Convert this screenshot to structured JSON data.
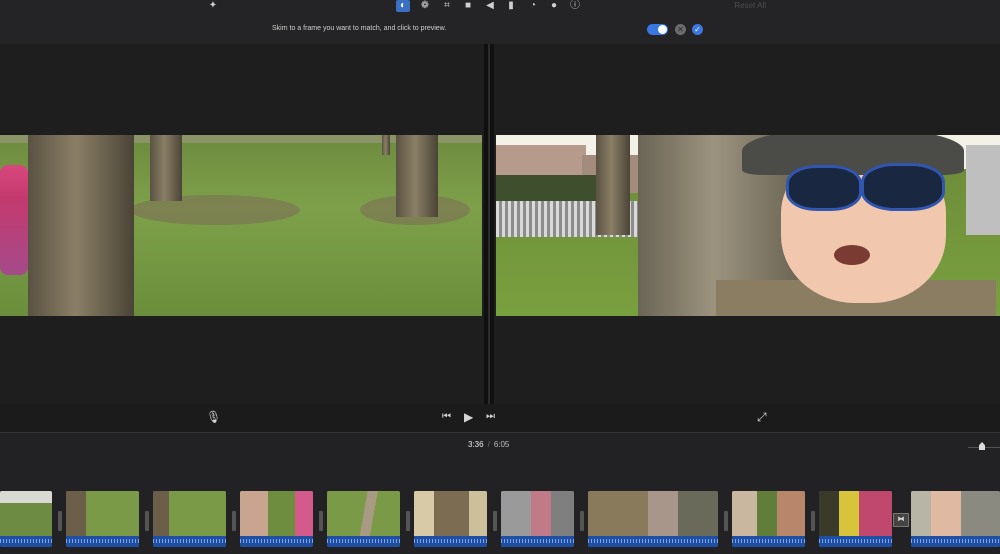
{
  "toolbar": {
    "icons": [
      "magic-wand",
      "color-balance",
      "color-correction",
      "crop",
      "camera-stabilization",
      "volume",
      "noise-reduction",
      "speed",
      "video-overlay",
      "info"
    ],
    "reset_all": "Reset All"
  },
  "hint": {
    "text": "Skim to a frame you want to match, and click to preview."
  },
  "playback": {
    "current_time": "3:36",
    "separator": "/",
    "total_time": "6:05"
  },
  "colors": {
    "accent": "#3a77e0",
    "background": "#1b1b1c",
    "audio_track": "#1f4fa2"
  },
  "timeline": {
    "clips": [
      {
        "index": 1,
        "scene": "park-grass"
      },
      {
        "index": 2,
        "scene": "park-children-running"
      },
      {
        "index": 3,
        "scene": "park-trees"
      },
      {
        "index": 4,
        "scene": "boy-with-girl-pink-helmet"
      },
      {
        "index": 5,
        "scene": "grass-path-girl"
      },
      {
        "index": 6,
        "scene": "tree-closeup"
      },
      {
        "index": 7,
        "scene": "street-path-girl"
      },
      {
        "index": 8,
        "scene": "garden-bushes-girl"
      },
      {
        "index": 9,
        "scene": "garden-house-boy"
      },
      {
        "index": 10,
        "scene": "boy-in-yellow"
      },
      {
        "index": 11,
        "scene": "girl-by-window"
      }
    ]
  }
}
